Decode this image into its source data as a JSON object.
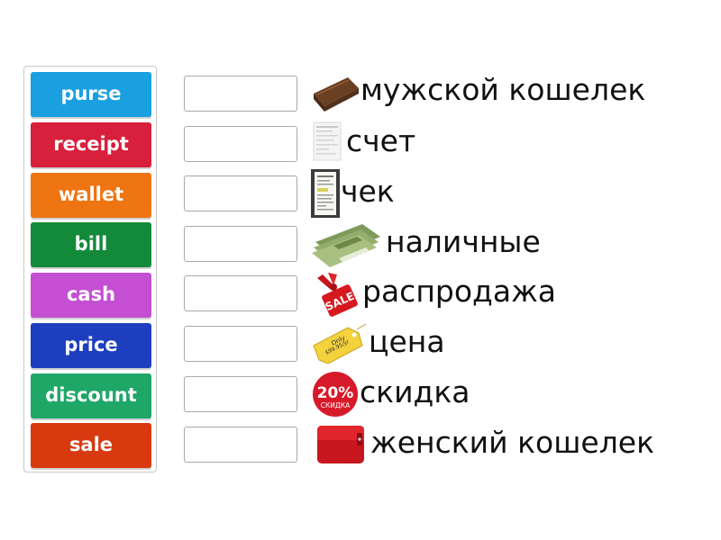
{
  "tiles": [
    {
      "label": "purse",
      "color": "#1a9fe0"
    },
    {
      "label": "receipt",
      "color": "#d81f3c"
    },
    {
      "label": "wallet",
      "color": "#ef7512"
    },
    {
      "label": "bill",
      "color": "#138a3a"
    },
    {
      "label": "cash",
      "color": "#c44fd2"
    },
    {
      "label": "price",
      "color": "#1d3fbf"
    },
    {
      "label": "discount",
      "color": "#1fa768"
    },
    {
      "label": "sale",
      "color": "#d8390f"
    }
  ],
  "rows": [
    {
      "label": "мужской кошелек",
      "icon": "brown-wallet-icon"
    },
    {
      "label": "счет",
      "icon": "bill-document-icon"
    },
    {
      "label": "чек",
      "icon": "receipt-icon"
    },
    {
      "label": "наличные",
      "icon": "cash-bundle-icon"
    },
    {
      "label": "распродажа",
      "icon": "sale-tag-icon"
    },
    {
      "label": "цена",
      "icon": "price-tag-icon"
    },
    {
      "label": "скидка",
      "icon": "discount-badge-icon"
    },
    {
      "label": "женский кошелек",
      "icon": "red-purse-icon"
    }
  ],
  "price_tag": {
    "line1": "Only",
    "line2": "$99.95/yr"
  },
  "discount_badge": {
    "percent": "20%",
    "word": "СКИДКА"
  },
  "sale_tag_text": "SALE"
}
